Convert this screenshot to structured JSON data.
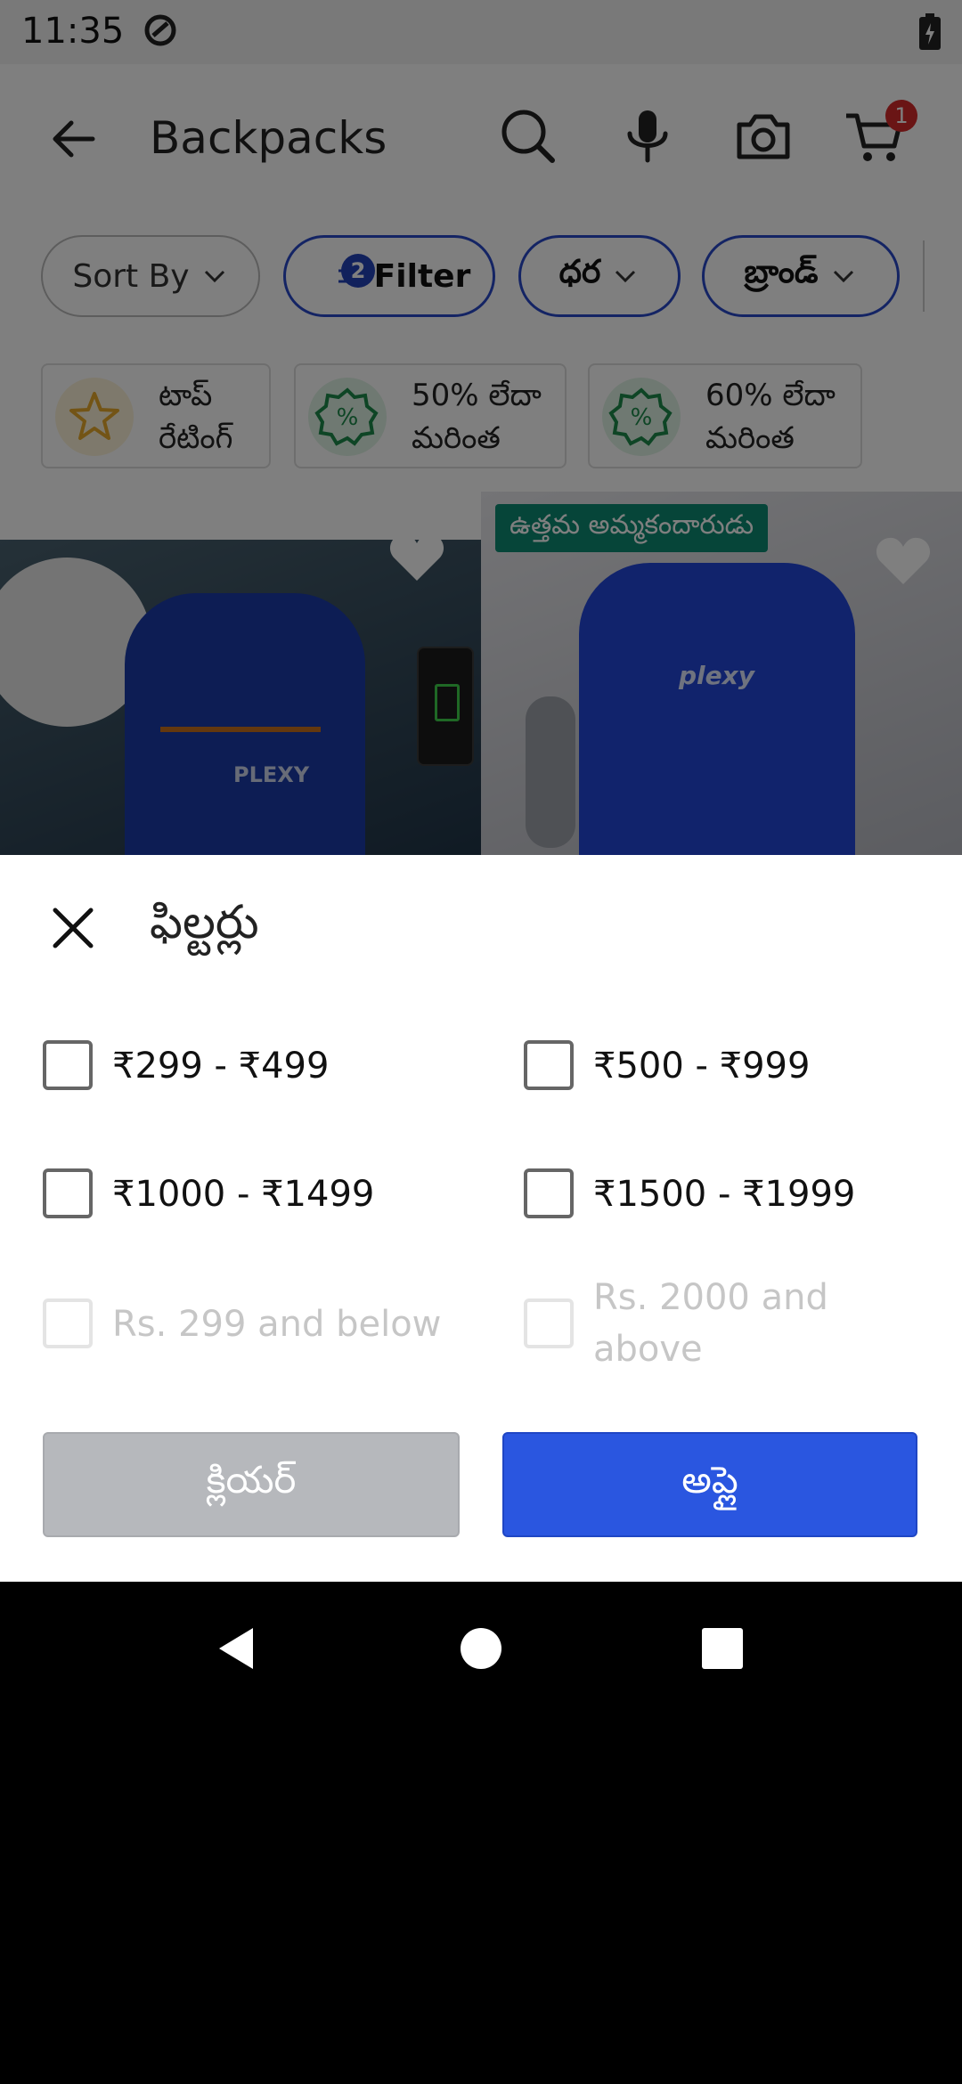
{
  "status_bar": {
    "time": "11:35"
  },
  "header": {
    "title": "Backpacks",
    "cart_count": "1"
  },
  "chips": {
    "sort": "Sort By",
    "filter": "Filter",
    "filter_badge": "2",
    "price": "ధర",
    "brand": "బ్రాండ్"
  },
  "quick_tiles": [
    {
      "label": "టాప్\nరేటింగ్",
      "icon": "star-icon",
      "color": "#f5c242"
    },
    {
      "label": "50% లేదా\nమరింత",
      "icon": "percent-icon",
      "color": "#1c8a4a"
    },
    {
      "label": "60% లేదా\nమరింత",
      "icon": "percent-icon",
      "color": "#1c8a4a"
    }
  ],
  "products": {
    "badge": "ఉత్తమ అమ్మకందారుడు",
    "brand_text_1": "PLEXY",
    "brand_text_2": "plexy"
  },
  "sheet": {
    "title": "ఫిల్టర్లు",
    "options": [
      {
        "label": "₹299 - ₹499",
        "checked": false,
        "enabled": true
      },
      {
        "label": "₹500 - ₹999",
        "checked": false,
        "enabled": true
      },
      {
        "label": "₹1000 - ₹1499",
        "checked": false,
        "enabled": true
      },
      {
        "label": "₹1500 - ₹1999",
        "checked": false,
        "enabled": true
      },
      {
        "label": "Rs. 299 and below",
        "checked": false,
        "enabled": false
      },
      {
        "label": "Rs. 2000 and above",
        "checked": false,
        "enabled": false
      }
    ],
    "clear_label": "క్లియర్",
    "apply_label": "అప్లై"
  },
  "colors": {
    "accent": "#2a56e0",
    "chip_border": "#2848c8",
    "clear_bg": "#b6b8bc"
  }
}
